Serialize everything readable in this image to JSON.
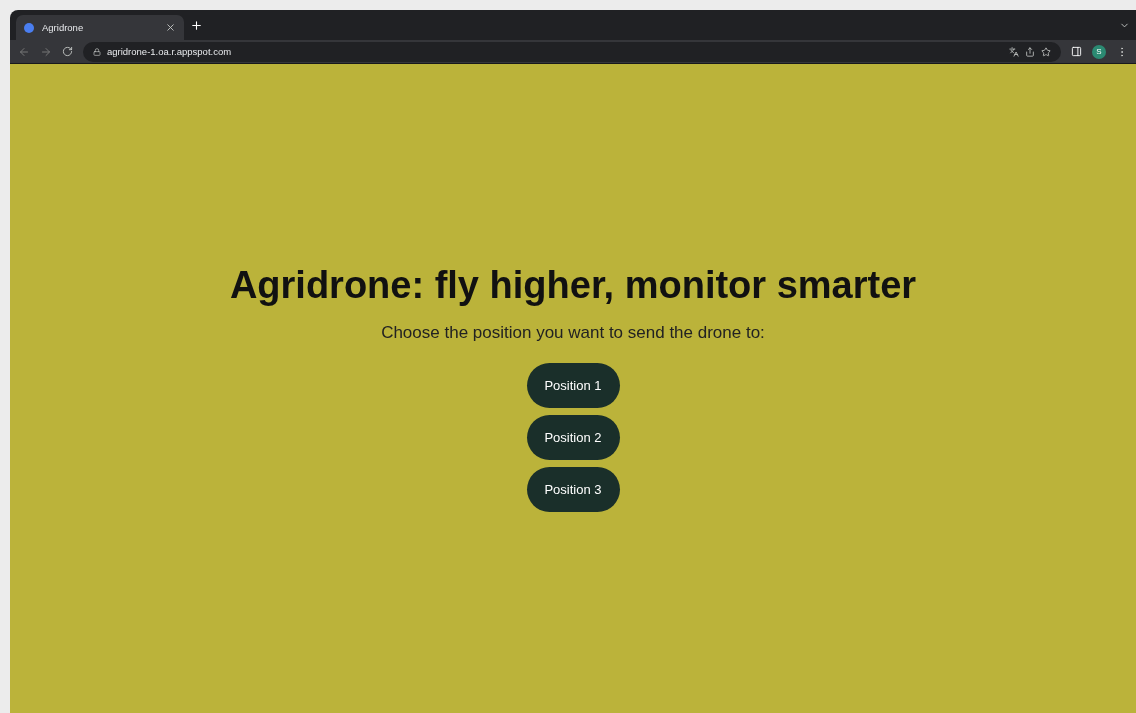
{
  "browser": {
    "tabs": [
      {
        "title": "Agridrone",
        "selected": true
      }
    ],
    "address": "agridrone-1.oa.r.appspot.com",
    "profile_initial": "S"
  },
  "page": {
    "title": "Agridrone: fly higher, monitor smarter",
    "prompt": "Choose the position you want to send the drone to:",
    "buttons": [
      {
        "label": "Position 1"
      },
      {
        "label": "Position 2"
      },
      {
        "label": "Position 3"
      }
    ]
  }
}
